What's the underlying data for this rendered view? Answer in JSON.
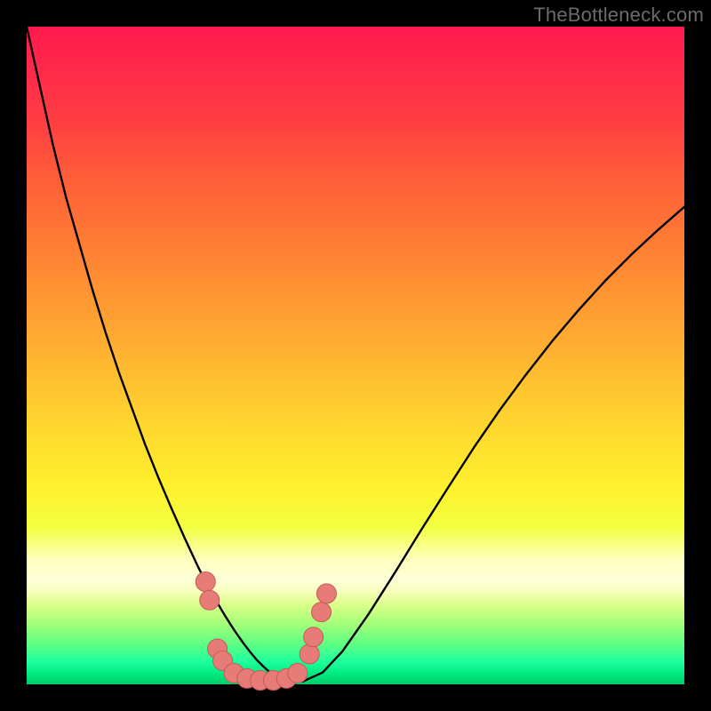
{
  "watermark": "TheBottleneck.com",
  "colors": {
    "curve_stroke": "#000000",
    "marker_fill": "#e77b78",
    "marker_stroke": "#c55a58",
    "frame": "#000000"
  },
  "chart_data": {
    "type": "line",
    "title": "",
    "xlabel": "",
    "ylabel": "",
    "xlim": [
      0,
      100
    ],
    "ylim": [
      0,
      100
    ],
    "grid": false,
    "legend": false,
    "curve": {
      "x": [
        0,
        2,
        4,
        6,
        8,
        10,
        12,
        14,
        16,
        18,
        20,
        22,
        24,
        26,
        27,
        28,
        29,
        30,
        31,
        32,
        33,
        34,
        35,
        36,
        37,
        38,
        39,
        40,
        42,
        45,
        48,
        52,
        56,
        60,
        64,
        68,
        72,
        76,
        80,
        84,
        88,
        92,
        96,
        100
      ],
      "y": [
        100,
        91,
        82,
        74,
        67,
        60,
        53.5,
        47.5,
        42,
        36.5,
        31.5,
        26.8,
        22.3,
        18,
        16,
        14.2,
        12.4,
        10.7,
        9.1,
        7.6,
        6.2,
        4.9,
        3.7,
        2.7,
        1.8,
        1.1,
        0.55,
        0.4,
        0.45,
        1.8,
        5.0,
        10.7,
        17.0,
        23.5,
        29.8,
        36.0,
        41.8,
        47.2,
        52.3,
        57.0,
        61.4,
        65.4,
        69.1,
        72.6
      ]
    },
    "markers": [
      {
        "x": 27.2,
        "y": 15.6
      },
      {
        "x": 27.8,
        "y": 12.8
      },
      {
        "x": 29.0,
        "y": 5.4
      },
      {
        "x": 29.8,
        "y": 3.6
      },
      {
        "x": 31.5,
        "y": 1.7
      },
      {
        "x": 33.5,
        "y": 0.9
      },
      {
        "x": 35.5,
        "y": 0.6
      },
      {
        "x": 37.5,
        "y": 0.6
      },
      {
        "x": 39.5,
        "y": 0.9
      },
      {
        "x": 41.2,
        "y": 1.7
      },
      {
        "x": 43.0,
        "y": 4.6
      },
      {
        "x": 43.6,
        "y": 7.2
      },
      {
        "x": 44.8,
        "y": 11.0
      },
      {
        "x": 45.6,
        "y": 13.8
      }
    ]
  }
}
